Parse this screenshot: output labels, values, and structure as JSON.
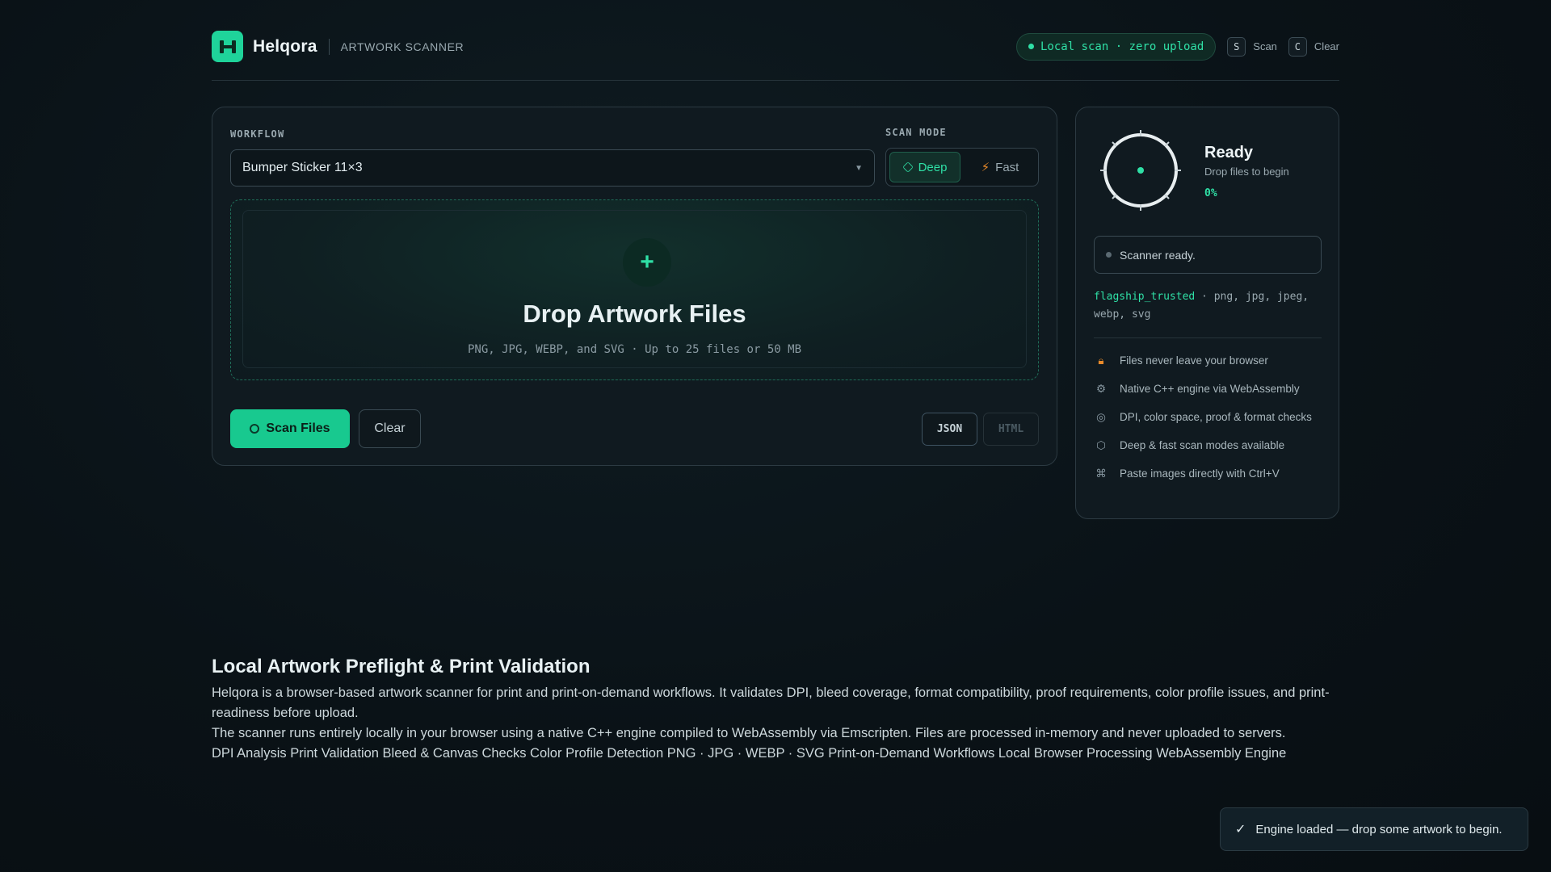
{
  "header": {
    "brand_name": "Helqora",
    "brand_sub": "ARTWORK SCANNER",
    "local_pill": "Local scan · zero upload",
    "shortcuts": [
      {
        "key": "S",
        "label": "Scan"
      },
      {
        "key": "C",
        "label": "Clear"
      }
    ]
  },
  "main": {
    "workflow_label": "WORKFLOW",
    "workflow_value": "Bumper Sticker 11×3",
    "scan_mode_label": "SCAN MODE",
    "mode_deep": "Deep",
    "mode_fast": "Fast",
    "active_mode": "Deep",
    "dropzone_plus": "+",
    "dropzone_title": "Drop Artwork Files",
    "dropzone_sub": "PNG, JPG, WEBP, and SVG · Up to 25 files or 50 MB",
    "scan_button": "Scan Files",
    "clear_button": "Clear",
    "json_button": "JSON",
    "html_button": "HTML"
  },
  "status": {
    "title": "Ready",
    "subtitle": "Drop files to begin",
    "percent": "0%",
    "scanner_message": "Scanner ready.",
    "formats_highlight": "flagship_trusted",
    "formats_rest": " · png, jpg, jpeg, webp, svg",
    "features": [
      {
        "icon": "lock-icon",
        "text": "Files never leave your browser"
      },
      {
        "icon": "gear-icon",
        "text": "Native C++ engine via WebAssembly"
      },
      {
        "icon": "target-icon",
        "text": "DPI, color space, proof & format checks"
      },
      {
        "icon": "hexagon-icon",
        "text": "Deep & fast scan modes available"
      },
      {
        "icon": "command-icon",
        "text": "Paste images directly with Ctrl+V"
      }
    ]
  },
  "seo": {
    "heading": "Local Artwork Preflight & Print Validation",
    "para1": "Helqora is a browser-based artwork scanner for print and print-on-demand workflows. It validates DPI, bleed coverage, format compatibility, proof requirements, color profile issues, and print-readiness before upload.",
    "para2": "The scanner runs entirely locally in your browser using a native C++ engine compiled to WebAssembly via Emscripten. Files are processed in-memory and never uploaded to servers.",
    "para3": "DPI Analysis Print Validation Bleed & Canvas Checks Color Profile Detection PNG · JPG · WEBP · SVG Print-on-Demand Workflows Local Browser Processing WebAssembly Engine"
  },
  "toast": {
    "check": "✓",
    "message": "Engine loaded — drop some artwork to begin."
  },
  "colors": {
    "accent": "#2fe0a6",
    "primary_button": "#18c98f",
    "background": "#0a1217",
    "card": "#101a20",
    "warning_icon": "#e88a2a"
  }
}
